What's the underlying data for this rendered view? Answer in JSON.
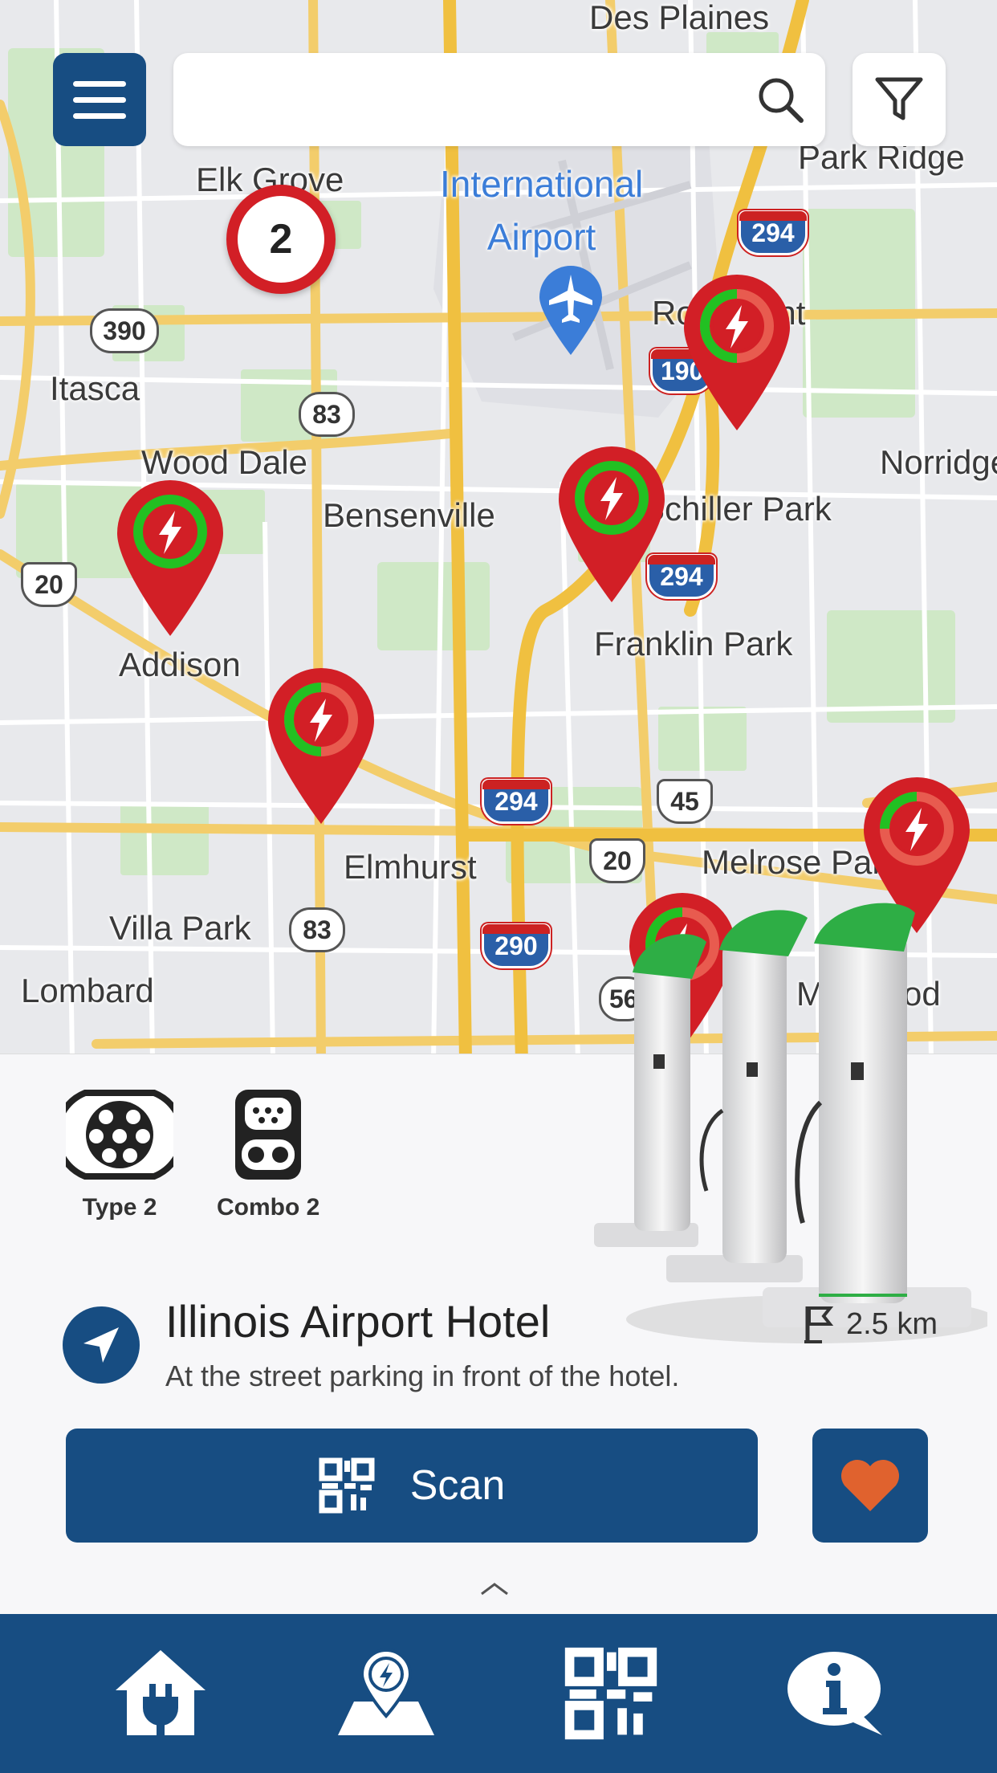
{
  "search": {
    "placeholder": "",
    "value": ""
  },
  "map": {
    "places": [
      "Des Plaines",
      "Park Ridge",
      "Elk Grove",
      "Itasca",
      "Wood Dale",
      "Bensenville",
      "Rosemont",
      "Norridge",
      "Schiller Park",
      "Franklin Park",
      "Addison",
      "Elmhurst",
      "Melrose Park",
      "Villa Park",
      "Lombard",
      "Maywood"
    ],
    "airport_label_line1": "International",
    "airport_label_line2": "Airport",
    "routes": [
      "390",
      "83",
      "20",
      "294",
      "294",
      "294",
      "190",
      "294",
      "45",
      "20",
      "83",
      "290",
      "56"
    ],
    "cluster_count": "2",
    "pin_colors": {
      "occupied": "#d21f26",
      "available": "#22c022",
      "partial": "#e85b4f"
    }
  },
  "connectors": [
    {
      "label": "Type 2",
      "icon": "type2-connector-icon"
    },
    {
      "label": "Combo 2",
      "icon": "combo2-connector-icon"
    }
  ],
  "station": {
    "name": "Illinois Airport Hotel",
    "description": "At the street parking in front of the hotel.",
    "distance": "2.5 km"
  },
  "actions": {
    "scan_label": "Scan"
  },
  "bottom_nav": [
    {
      "name": "home-plug",
      "icon": "home-plug-icon"
    },
    {
      "name": "map-pin",
      "icon": "map-charging-icon"
    },
    {
      "name": "qr",
      "icon": "qr-code-icon"
    },
    {
      "name": "info",
      "icon": "info-chat-icon"
    }
  ],
  "colors": {
    "primary": "#174d82",
    "heart": "#e0622e",
    "marker_red": "#d21f26",
    "marker_green": "#22c022"
  }
}
